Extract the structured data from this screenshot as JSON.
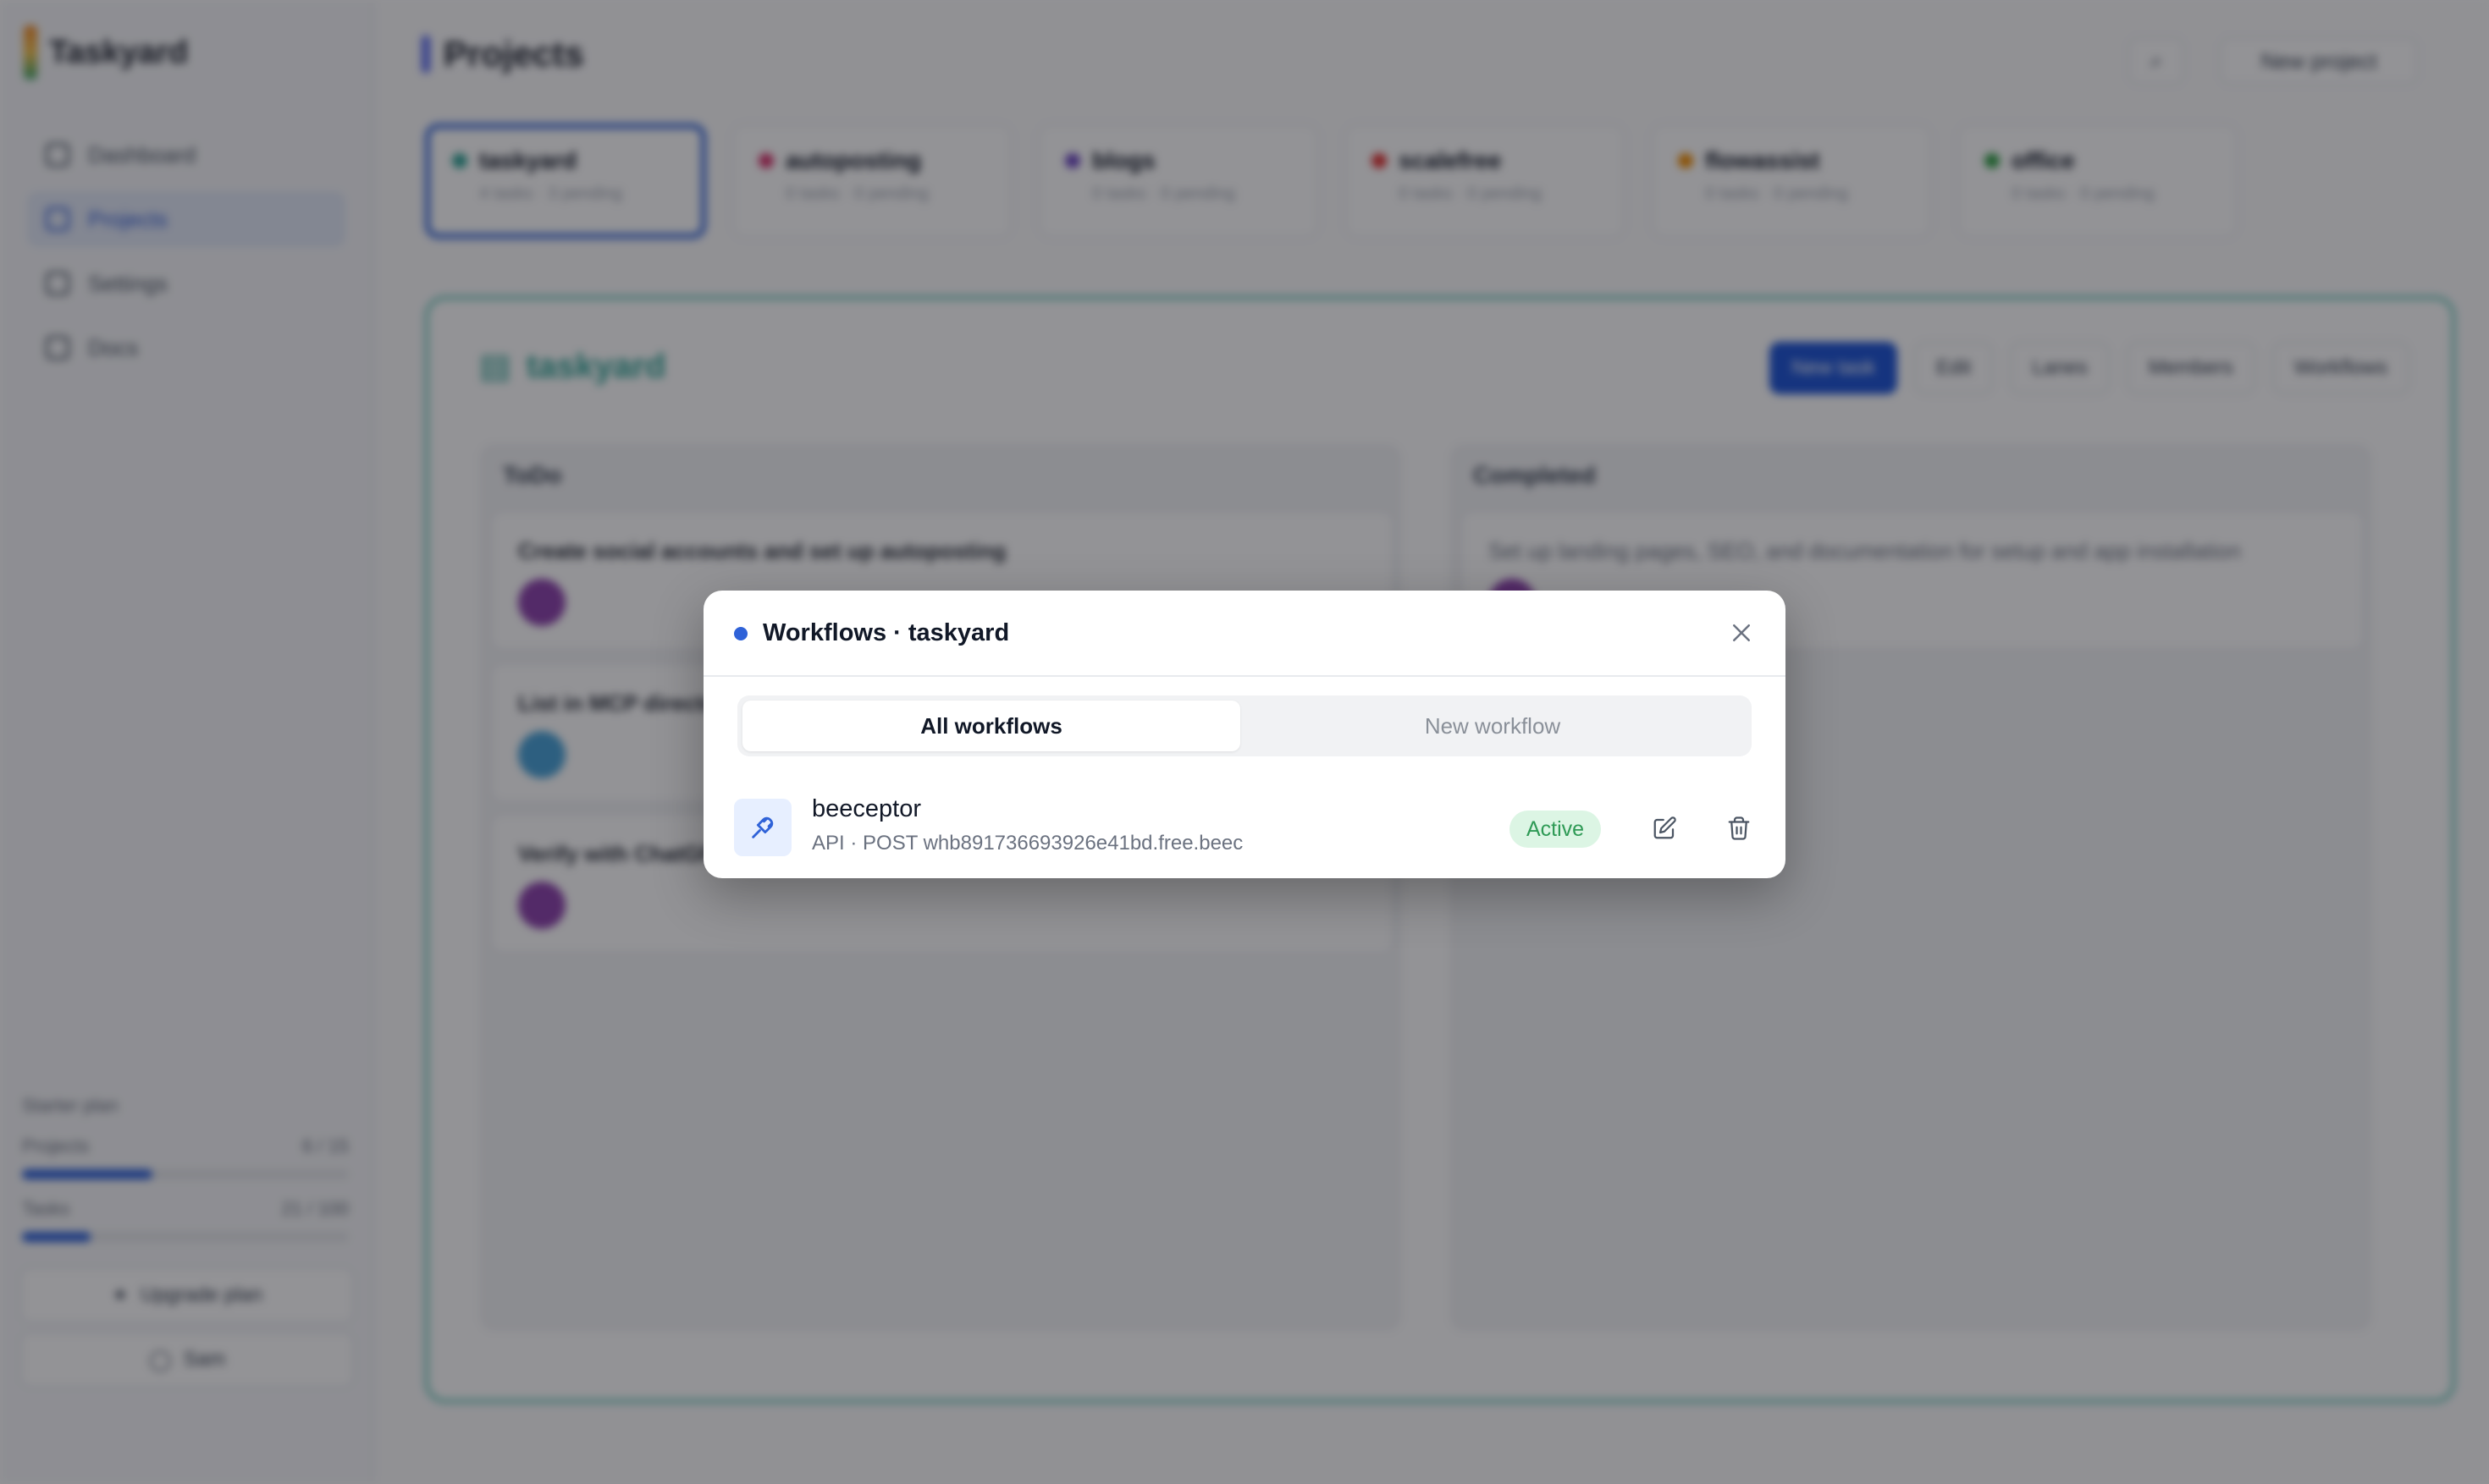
{
  "app": {
    "brand": "Taskyard",
    "nav": [
      {
        "label": "Dashboard"
      },
      {
        "label": "Projects"
      },
      {
        "label": "Settings"
      },
      {
        "label": "Docs"
      }
    ],
    "usage": {
      "title": "Starter plan",
      "projects_label": "Projects",
      "projects_count": "6 / 15",
      "projects_fill": 0.4,
      "tasks_label": "Tasks",
      "tasks_count": "21 / 100",
      "tasks_fill": 0.21
    },
    "upgrade_label": "Upgrade plan",
    "account_label": "Sam"
  },
  "page": {
    "title": "Projects",
    "new_project_label": "New project"
  },
  "projects": [
    {
      "name": "taskyard",
      "meta": "4 tasks · 3 pending",
      "color": "#2fa395"
    },
    {
      "name": "autoposting",
      "meta": "0 tasks · 0 pending",
      "color": "#d6336c"
    },
    {
      "name": "blogs",
      "meta": "0 tasks · 0 pending",
      "color": "#6b46c1"
    },
    {
      "name": "scalefree",
      "meta": "0 tasks · 0 pending",
      "color": "#e03131"
    },
    {
      "name": "flowassist",
      "meta": "0 tasks · 0 pending",
      "color": "#f08c00"
    },
    {
      "name": "office",
      "meta": "0 tasks · 0 pending",
      "color": "#2f9e44"
    }
  ],
  "board": {
    "title": "taskyard",
    "tools": [
      "New task",
      "Edit",
      "Lanes",
      "Members",
      "Workflows"
    ],
    "columns": [
      {
        "title": "ToDo",
        "tasks": [
          "Create social accounts and set up autoposting",
          "List in MCP directories",
          "Verify with ChatGPT"
        ]
      },
      {
        "title": "Completed",
        "tasks": [
          "Set up landing pages, SEO, and documentation for setup and app installation"
        ]
      }
    ]
  },
  "modal": {
    "title": "Workflows · taskyard",
    "dot_color": "#2f62d8",
    "tabs": {
      "all": "All workflows",
      "new": "New workflow"
    },
    "workflows": [
      {
        "name": "beeceptor",
        "meta": "API · POST whb891736693926e41bd.free.beec",
        "status": "Active",
        "icon": "plug-icon"
      }
    ]
  }
}
